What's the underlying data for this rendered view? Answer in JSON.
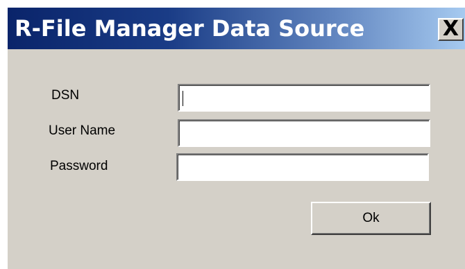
{
  "window": {
    "title": "R-File Manager Data Source",
    "close_label": "X"
  },
  "form": {
    "dsn_label": "DSN",
    "dsn_value": "",
    "username_label": "User Name",
    "username_value": "",
    "password_label": "Password",
    "password_value": "",
    "ok_label": "Ok"
  },
  "colors": {
    "titlebar_start": "#0a246a",
    "titlebar_end": "#a6caf0",
    "dialog_face": "#d4d0c8"
  }
}
